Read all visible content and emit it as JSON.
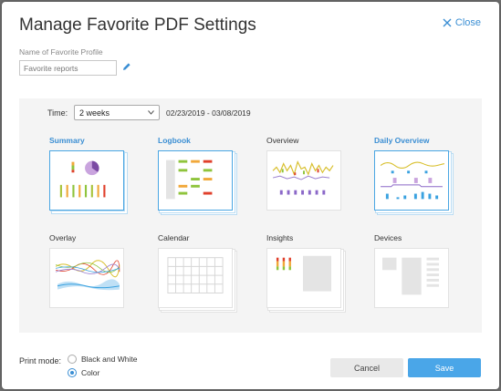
{
  "dialog": {
    "title": "Manage Favorite PDF Settings",
    "close_label": "Close"
  },
  "profile": {
    "name_label": "Name of Favorite Profile",
    "name_value": "Favorite reports"
  },
  "time": {
    "label": "Time:",
    "selected": "2 weeks",
    "date_range": "02/23/2019 - 03/08/2019"
  },
  "reports": [
    {
      "label": "Summary",
      "selected": true
    },
    {
      "label": "Logbook",
      "selected": true
    },
    {
      "label": "Overview",
      "selected": false
    },
    {
      "label": "Daily Overview",
      "selected": true
    },
    {
      "label": "Overlay",
      "selected": false
    },
    {
      "label": "Calendar",
      "selected": false
    },
    {
      "label": "Insights",
      "selected": false
    },
    {
      "label": "Devices",
      "selected": false
    }
  ],
  "print_mode": {
    "label": "Print mode:",
    "options": [
      {
        "label": "Black and White",
        "checked": false
      },
      {
        "label": "Color",
        "checked": true
      }
    ]
  },
  "actions": {
    "cancel_label": "Cancel",
    "save_label": "Save"
  },
  "colors": {
    "accent": "#3a8ed3",
    "save_button": "#4aa6e8",
    "selected_border": "#4aa6e3"
  }
}
